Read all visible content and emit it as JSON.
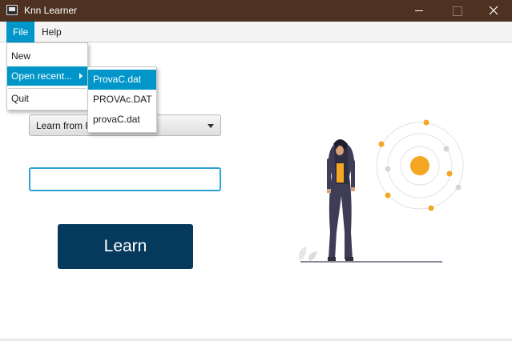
{
  "window": {
    "title": "Knn Learner"
  },
  "menubar": {
    "file": "File",
    "help": "Help"
  },
  "file_menu": {
    "items": [
      "New",
      "Open recent...",
      "Quit"
    ]
  },
  "recent_files": [
    "ProvaC.dat",
    "PROVAc.DAT",
    "provaC.dat"
  ],
  "combo": {
    "visible_text": "Learn from F"
  },
  "input": {
    "value": ""
  },
  "learn_button": {
    "label": "Learn"
  },
  "colors": {
    "titlebar": "#4e3120",
    "menu_highlight": "#0096c9",
    "button": "#053a5c",
    "input_focus": "#2ea3d6",
    "illustration_accent": "#f5a623"
  }
}
